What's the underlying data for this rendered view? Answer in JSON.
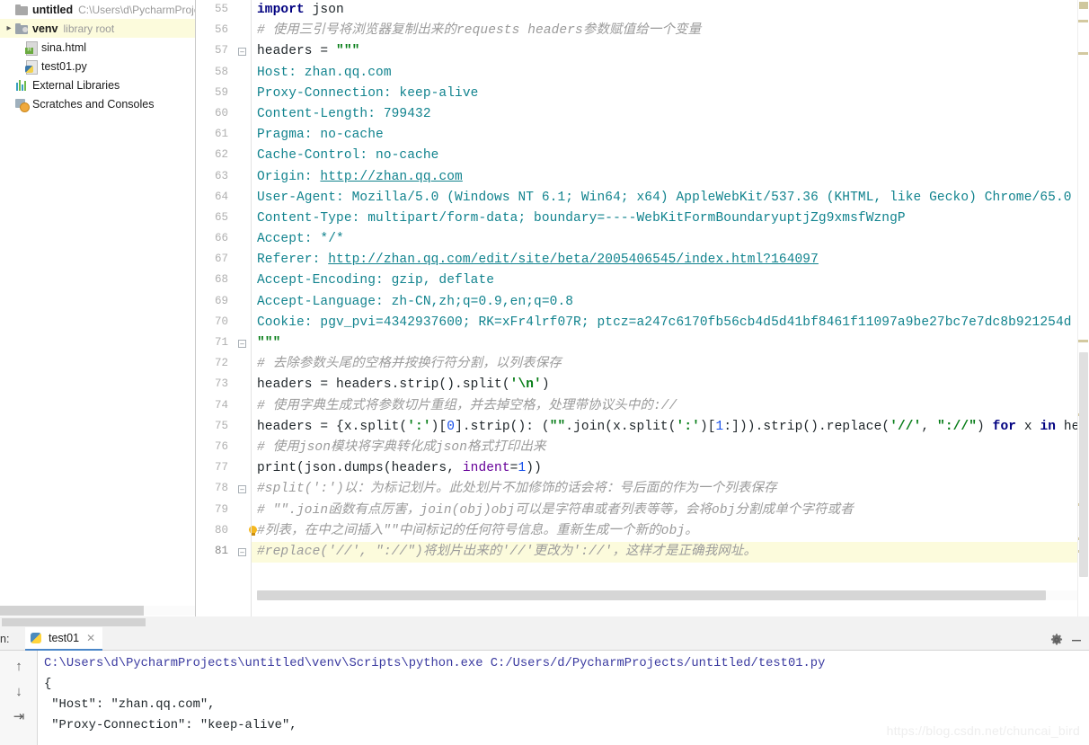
{
  "project": {
    "root": {
      "name": "untitled",
      "path": "C:\\Users\\d\\PycharmProje",
      "icon": "folder-icon"
    },
    "items": [
      {
        "name": "venv",
        "note": "library root",
        "icon": "folder-icon",
        "indent": 1,
        "expandable": true,
        "selected": true
      },
      {
        "name": "sina.html",
        "note": "",
        "icon": "html-file-icon",
        "indent": 2,
        "expandable": false,
        "selected": false
      },
      {
        "name": "test01.py",
        "note": "",
        "icon": "python-file-icon",
        "indent": 2,
        "expandable": false,
        "selected": false
      },
      {
        "name": "External Libraries",
        "note": "",
        "icon": "external-libraries-icon",
        "indent": 0,
        "expandable": false,
        "selected": false
      },
      {
        "name": "Scratches and Consoles",
        "note": "",
        "icon": "scratches-icon",
        "indent": 0,
        "expandable": false,
        "selected": false
      }
    ]
  },
  "editor": {
    "first_line": 55,
    "current_line": 81,
    "fold_lines": [
      57,
      71,
      78,
      81
    ],
    "bulb_line": 80,
    "lines": [
      {
        "n": 55,
        "html": "<span class=\"kw\">import</span> <span class=\"pl\">json</span>"
      },
      {
        "n": 56,
        "html": "<span class=\"cm\"># 使用三引号将浏览器复制出来的requests headers参数赋值给一个变量</span>"
      },
      {
        "n": 57,
        "html": "<span class=\"pl\">headers = </span><span class=\"sq\">\"\"\"</span>"
      },
      {
        "n": 58,
        "html": "<span class=\"hdr\">Host: zhan.qq.com</span>"
      },
      {
        "n": 59,
        "html": "<span class=\"hdr\">Proxy-Connection: keep-alive</span>"
      },
      {
        "n": 60,
        "html": "<span class=\"hdr\">Content-Length: 799432</span>"
      },
      {
        "n": 61,
        "html": "<span class=\"hdr\">Pragma: no-cache</span>"
      },
      {
        "n": 62,
        "html": "<span class=\"hdr\">Cache-Control: no-cache</span>"
      },
      {
        "n": 63,
        "html": "<span class=\"hdr\">Origin: </span><span class=\"lnk\">http://zhan.qq.com</span>"
      },
      {
        "n": 64,
        "html": "<span class=\"hdr\">User-Agent: Mozilla/5.0 (Windows NT 6.1; Win64; x64) AppleWebKit/537.36 (KHTML, like Gecko) Chrome/65.0</span>"
      },
      {
        "n": 65,
        "html": "<span class=\"hdr\">Content-Type: multipart/form-data; boundary=----WebKitFormBoundaryuptjZg9xmsfWzngP</span>"
      },
      {
        "n": 66,
        "html": "<span class=\"hdr\">Accept: */*</span>"
      },
      {
        "n": 67,
        "html": "<span class=\"hdr\">Referer: </span><span class=\"lnk\">http://zhan.qq.com/edit/site/beta/2005406545/index.html?164097</span>"
      },
      {
        "n": 68,
        "html": "<span class=\"hdr\">Accept-Encoding: gzip, deflate</span>"
      },
      {
        "n": 69,
        "html": "<span class=\"hdr\">Accept-Language: zh-CN,zh;q=0.9,en;q=0.8</span>"
      },
      {
        "n": 70,
        "html": "<span class=\"hdr\">Cookie: pgv_pvi=4342937600; RK=xFr4lrf07R; ptcz=a247c6170fb56cb4d5d41bf8461f11097a9be27bc7e7dc8b921254d</span>"
      },
      {
        "n": 71,
        "html": "<span class=\"sq\">\"\"\"</span>"
      },
      {
        "n": 72,
        "html": "<span class=\"cm\"># 去除参数头尾的空格并按换行符分割，以列表保存</span>"
      },
      {
        "n": 73,
        "html": "<span class=\"pl\">headers = headers.strip().split(</span><span class=\"sq\">'\\n'</span><span class=\"pl\">)</span>"
      },
      {
        "n": 74,
        "html": "<span class=\"cm\"># 使用字典生成式将参数切片重组，并去掉空格，处理带协议头中的://</span>"
      },
      {
        "n": 75,
        "html": "<span class=\"pl\">headers = {x.split(</span><span class=\"sq\">':'</span><span class=\"pl\">)[</span><span class=\"num\">0</span><span class=\"pl\">].strip(): (</span><span class=\"sq\">\"\"</span><span class=\"pl\">.join(x.split(</span><span class=\"sq\">':'</span><span class=\"pl\">)[</span><span class=\"num\">1</span><span class=\"pl\">:])).strip().replace(</span><span class=\"sq\">'//'</span><span class=\"pl\">, </span><span class=\"sq\">\"://\"</span><span class=\"pl\">) </span><span class=\"kw\">for</span><span class=\"pl\"> x </span><span class=\"kw\">in</span><span class=\"pl\"> headers}</span>"
      },
      {
        "n": 76,
        "html": "<span class=\"cm\"># 使用json模块将字典转化成json格式打印出来</span>"
      },
      {
        "n": 77,
        "html": "<span class=\"pl\">print(json.dumps(headers, </span><span class=\"named\">indent</span><span class=\"pl\">=</span><span class=\"num\">1</span><span class=\"pl\">))</span>"
      },
      {
        "n": 78,
        "html": "<span class=\"cm\">#split(':')以：为标记划片。此处划片不加修饰的话会将：号后面的作为一个列表保存</span>"
      },
      {
        "n": 79,
        "html": "<span class=\"cm\"># \"\".join函数有点厉害，join(obj)obj可以是字符串或者列表等等，会将obj分割成单个字符或者</span>"
      },
      {
        "n": 80,
        "html": "<span class=\"cm\">#列表，在中之间插入\"\"中间标记的任何符号信息。重新生成一个新的obj。</span>"
      },
      {
        "n": 81,
        "html": "<span class=\"cm\">#replace('//', \"://\")将划片出来的'//'更改为'://'，这样才是正确我网址。</span>"
      }
    ]
  },
  "console": {
    "run_label": "n:",
    "tab_label": "test01",
    "tab_close": "✕",
    "gear_icon": "gear-icon",
    "minimize_icon": "minimize-icon",
    "side_buttons": [
      {
        "icon": "scroll-up-icon",
        "glyph": "↑"
      },
      {
        "icon": "scroll-down-icon",
        "glyph": "↓"
      },
      {
        "icon": "soft-wrap-icon",
        "glyph": "⇥"
      }
    ],
    "output": [
      {
        "text": "C:\\Users\\d\\PycharmProjects\\untitled\\venv\\Scripts\\python.exe C:/Users/d/PycharmProjects/untitled/test01.py",
        "kind": "path"
      },
      {
        "text": "{",
        "kind": "plain"
      },
      {
        "text": " \"Host\": \"zhan.qq.com\",",
        "kind": "plain"
      },
      {
        "text": " \"Proxy-Connection\": \"keep-alive\",",
        "kind": "plain"
      }
    ]
  },
  "watermark": {
    "text": "https://blog.csdn.net/chuncai_bird"
  },
  "colors": {
    "header_string": "#11838e",
    "comment": "#9b9b9b",
    "keyword": "#000080",
    "number": "#1750eb",
    "selection": "#fcfbdc",
    "tab_underline": "#4a86c8"
  }
}
